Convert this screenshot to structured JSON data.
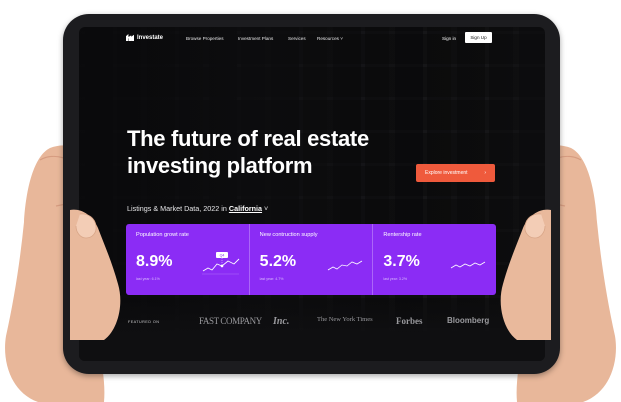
{
  "nav": {
    "logo": "Investate",
    "links": [
      "Browse Properties",
      "Investment Plans",
      "Services",
      "Resources"
    ],
    "signin": "Sign in",
    "signup": "Sign Up"
  },
  "hero": {
    "title_line1": "The future of real estate",
    "title_line2": "investing platform",
    "subtitle_prefix": "Listings & Market Data, 2022 in",
    "location": "California",
    "cta": "Explore investment"
  },
  "stats": [
    {
      "label": "Population growt rate",
      "value": "8.9%",
      "note": "last year: 6.1%",
      "tag": "Q4"
    },
    {
      "label": "New contruction supply",
      "value": "5.2%",
      "note": "last year: 4.7%"
    },
    {
      "label": "Rentership rate",
      "value": "3.7%",
      "note": "last year: 3.2%"
    }
  ],
  "featured": {
    "label": "FEATURED ON",
    "brands": [
      "FAST COMPANY",
      "Inc.",
      "The New York Times",
      "Forbes",
      "Bloomberg"
    ]
  },
  "colors": {
    "accent": "#8b2cf5",
    "cta": "#ef5a3c",
    "bezel": "#1c1c1f"
  }
}
